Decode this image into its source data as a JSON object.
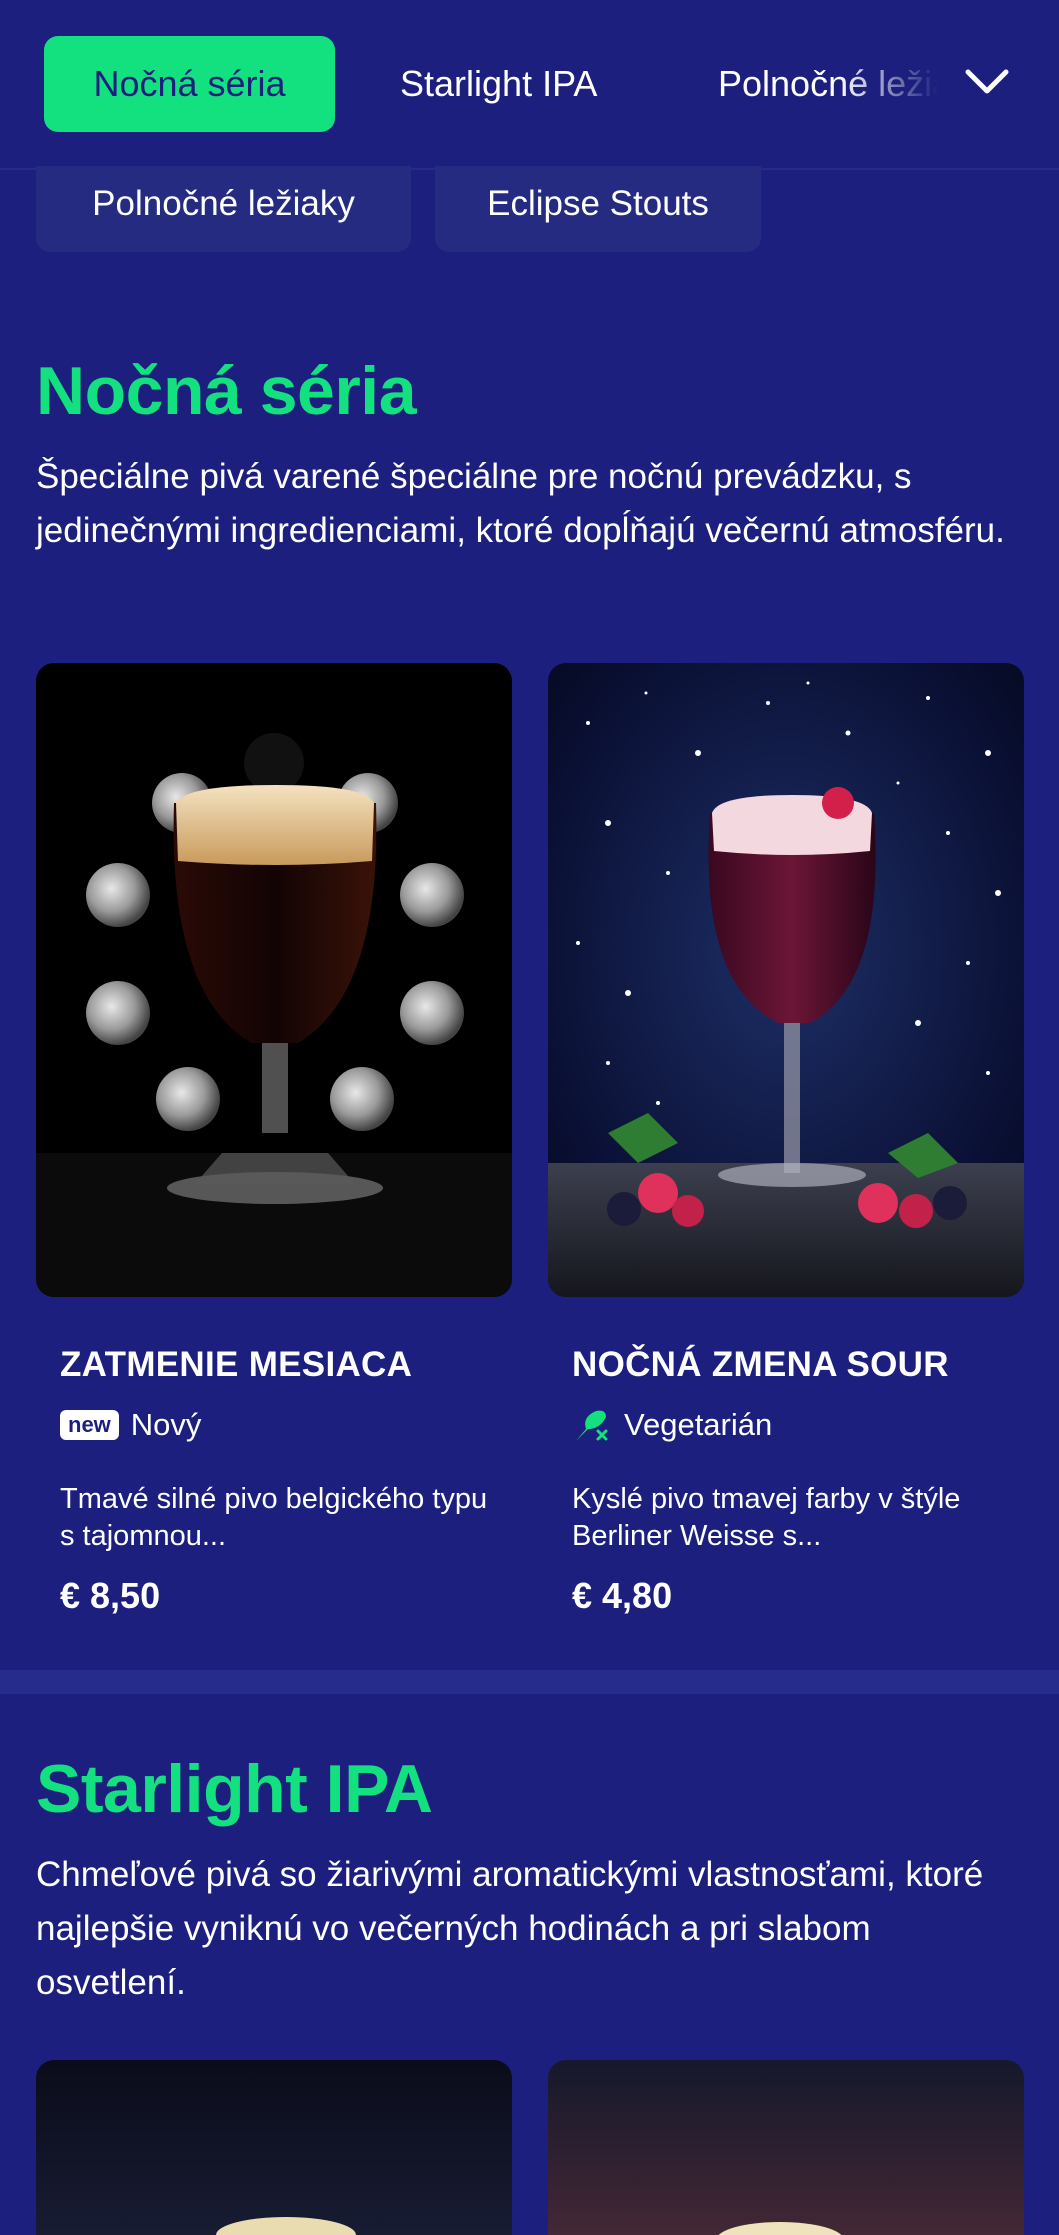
{
  "tabs": {
    "active": "Nočná séria",
    "second": "Starlight IPA",
    "third": "Polnočné ležiaky",
    "more_icon": "chevron-down-icon"
  },
  "chips": [
    "Polnočné ležiaky",
    "Eclipse Stouts"
  ],
  "section1": {
    "title": "Nočná séria",
    "description": "Špeciálne pivá varené špeciálne pre nočnú prevádzku, s jedinečnými ingredienciami, ktoré dopĺňajú večernú atmosféru.",
    "items": [
      {
        "name": "ZATMENIE MESIACA",
        "badge_short": "new",
        "badge": "Nový",
        "description": "Tmavé silné pivo belgického typu s tajomnou...",
        "price": "€ 8,50"
      },
      {
        "name": "NOČNÁ ZMENA SOUR",
        "badge_icon": "vegetarian-icon",
        "badge": "Vegetarián",
        "description": "Kyslé pivo tmavej farby v štýle Berliner Weisse s...",
        "price": "€ 4,80"
      }
    ]
  },
  "section2": {
    "title": "Starlight IPA",
    "description": "Chmeľové pivá so žiarivými aromatickými vlastnosťami, ktoré najlepšie vyniknú vo večerných hodinách a pri slabom osvetlení."
  },
  "colors": {
    "background": "#1c1f7d",
    "accent": "#13e07f",
    "chip": "#242b80"
  }
}
